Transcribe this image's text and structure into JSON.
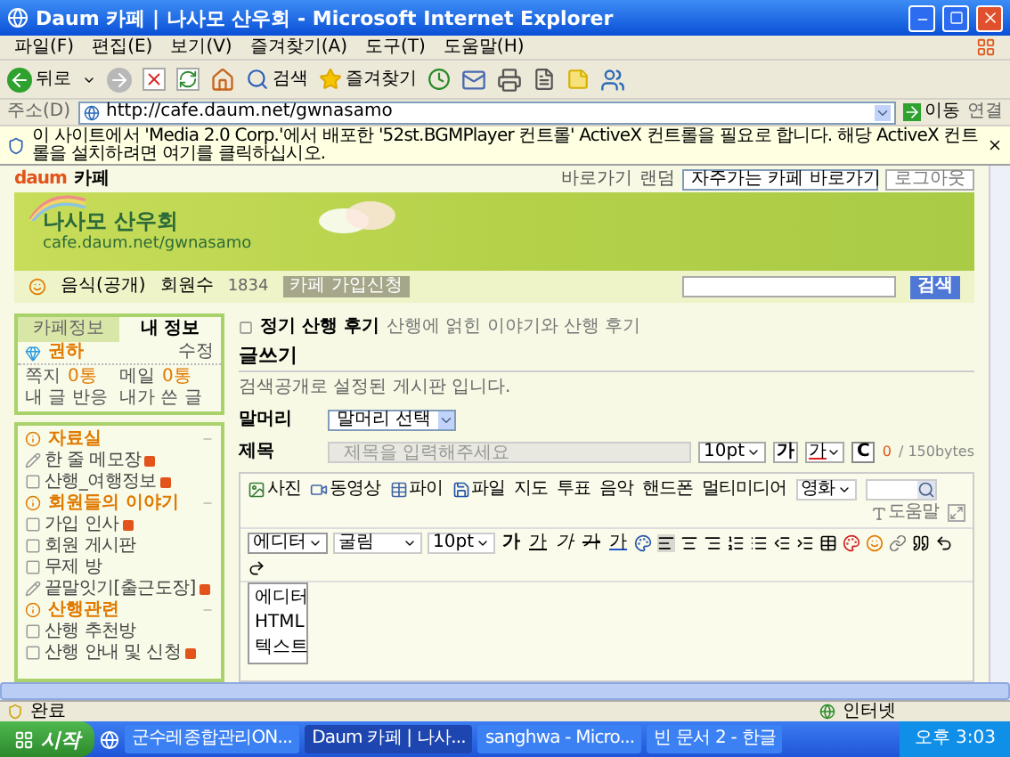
{
  "window": {
    "title": "Daum 카페 | 나사모 산우회 - Microsoft Internet Explorer"
  },
  "menu": [
    "파일(F)",
    "편집(E)",
    "보기(V)",
    "즐겨찾기(A)",
    "도구(T)",
    "도움말(H)"
  ],
  "toolbar": {
    "back": "뒤로",
    "search": "검색",
    "favorites": "즐겨찾기"
  },
  "address": {
    "label": "주소(D)",
    "url": "http://cafe.daum.net/gwnasamo",
    "go": "이동",
    "links": "연결"
  },
  "info_bar": "이 사이트에서 'Media 2.0 Corp.'에서 배포한 '52st.BGMPlayer 컨트롤' ActiveX 컨트롤을 필요로 합니다. 해당 ActiveX 컨트롤을 설치하려면 여기를 클릭하십시오.",
  "daum_bar": {
    "logo": "daum",
    "service": "카페",
    "shortcut": "바로가기",
    "random": "랜덤",
    "cafe_select": "자주가는 카페 바로가기",
    "logout": "로그아웃"
  },
  "banner": {
    "cafe_name": "나사모 산우회",
    "cafe_url": "cafe.daum.net/gwnasamo"
  },
  "cafe_bar": {
    "category": "음식(공개)",
    "members_label": "회원수",
    "members": "1834",
    "join": "카페 가입신청",
    "search_button": "검색"
  },
  "sidebar": {
    "tabs": [
      {
        "label": "카페정보",
        "selected": false
      },
      {
        "label": "내 정보",
        "selected": true
      }
    ],
    "user": {
      "name": "권하",
      "edit": "수정"
    },
    "stats": [
      {
        "label": "쪽지",
        "count": "0통"
      },
      {
        "label": "메일",
        "count": "0통"
      }
    ],
    "links": [
      "내 글 반응",
      "내가 쓴 글"
    ],
    "groups": [
      {
        "title": "자료실",
        "children": [
          {
            "kind": "memo",
            "label": "한 줄 메모장",
            "new": true
          },
          {
            "kind": "board",
            "label": "산행_여행정보",
            "new": true
          }
        ]
      },
      {
        "title": "회원들의 이야기",
        "children": [
          {
            "kind": "board",
            "label": "가입 인사",
            "new": true
          },
          {
            "kind": "board",
            "label": "회원 게시판",
            "new": false
          },
          {
            "kind": "board",
            "label": "무제 방",
            "new": false
          },
          {
            "kind": "memo",
            "label": "끝말잇기[출근도장]",
            "new": true
          }
        ]
      },
      {
        "title": "산행관련",
        "children": [
          {
            "kind": "board",
            "label": "산행 추천방",
            "new": false
          },
          {
            "kind": "board",
            "label": "산행 안내 및 신청",
            "new": true
          }
        ]
      }
    ]
  },
  "board": {
    "name": "정기 산행 후기",
    "description": "산행에 얽힌 이야기와 산행 후기",
    "heading": "글쓰기",
    "note": "검색공개로 설정된 게시판 입니다.",
    "prefix_label": "말머리",
    "prefix_select": "말머리 선택",
    "subject_label": "제목",
    "subject_placeholder": "제목을 입력해주세요",
    "subject_size": "10pt",
    "subject_bold": "가",
    "subject_color": "가",
    "clear": "C",
    "bytes_used": "0",
    "bytes_limit": "/ 150bytes"
  },
  "editor": {
    "attach": [
      {
        "kind": "photo",
        "label": "사진"
      },
      {
        "kind": "video",
        "label": "동영상"
      },
      {
        "kind": "table",
        "label": "파이"
      },
      {
        "kind": "file",
        "label": "파일"
      },
      {
        "kind": "plain",
        "label": "지도"
      },
      {
        "kind": "plain",
        "label": "투표"
      },
      {
        "kind": "plain",
        "label": "음악"
      },
      {
        "kind": "plain",
        "label": "핸드폰"
      },
      {
        "kind": "plain",
        "label": "멀티미디어"
      }
    ],
    "media_select": "영화",
    "help": "도움말",
    "mode": "에디터",
    "font": "굴림",
    "size": "10pt",
    "format": [
      {
        "kind": "bold",
        "label": "가"
      },
      {
        "kind": "underline",
        "label": "가"
      },
      {
        "kind": "italic",
        "label": "가"
      },
      {
        "kind": "strike",
        "label": "가"
      },
      {
        "kind": "color",
        "label": "가"
      }
    ],
    "mode_menu": [
      "에디터",
      "HTML",
      "텍스트"
    ]
  },
  "status_bar": {
    "text": "완료",
    "zone": "인터넷"
  },
  "taskbar": {
    "start": "시작",
    "tasks": [
      {
        "label": "군수레종합관리ON...",
        "selected": false
      },
      {
        "label": "Daum 카페 | 나사...",
        "selected": true
      },
      {
        "label": "sanghwa - Micro...",
        "selected": false
      },
      {
        "label": "빈 문서 2 - 한글",
        "selected": false
      }
    ],
    "clock": "오후 3:03"
  }
}
